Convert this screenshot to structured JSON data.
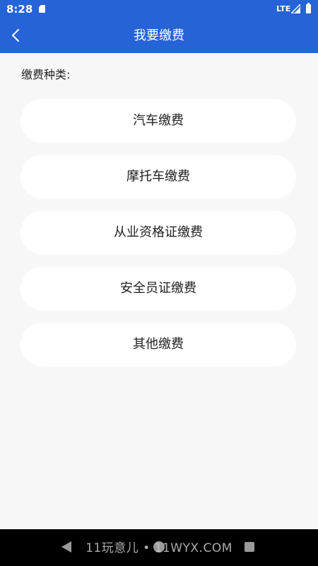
{
  "status_bar": {
    "time": "8:28",
    "network": "LTE"
  },
  "toolbar": {
    "title": "我要缴费"
  },
  "section": {
    "label": "缴费种类:"
  },
  "fee_types": [
    {
      "label": "汽车缴费"
    },
    {
      "label": "摩托车缴费"
    },
    {
      "label": "从业资格证缴费"
    },
    {
      "label": "安全员证缴费"
    },
    {
      "label": "其他缴费"
    }
  ],
  "watermark": {
    "text": "11玩意儿 • 11WYX.COM"
  },
  "colors": {
    "primary": "#2563d6",
    "background": "#f7f7f7",
    "card": "#ffffff",
    "text": "#222222"
  },
  "icons": {
    "back": "chevron-left-icon",
    "sd_card": "sd-card-icon",
    "signal": "signal-icon",
    "battery": "battery-icon"
  }
}
